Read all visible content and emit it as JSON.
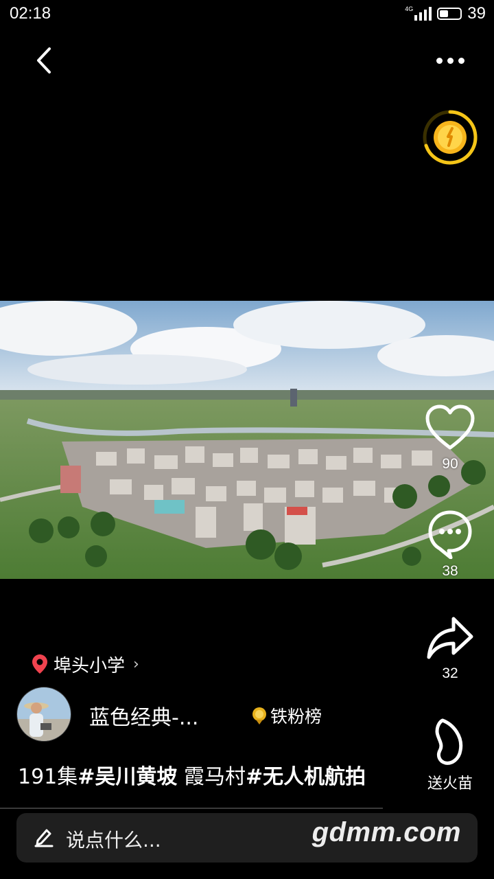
{
  "status_bar": {
    "time": "02:18",
    "network": "4G",
    "battery": "39"
  },
  "header": {
    "back_icon": "chevron-left-icon",
    "more_icon": "more-dots-icon"
  },
  "coin_widget": {
    "icon": "gold-coin-icon",
    "ring_color": "#f5c518"
  },
  "actions": {
    "like_count": "90",
    "comment_count": "38",
    "share_count": "32",
    "gift_label": "送火苗"
  },
  "location": {
    "label": "埠头小学",
    "icon": "location-pin-icon",
    "pin_color": "#f0434f"
  },
  "author": {
    "name": "蓝色经典-...",
    "badge_label": "铁粉榜",
    "badge_color": "#e8b21c"
  },
  "caption": {
    "part1": "191集",
    "part2": "#吴川黄坡",
    "part3": " 霞马村",
    "part4": "#无人机航拍"
  },
  "comment_bar": {
    "placeholder": "说点什么...",
    "watermark": "gdmm.com"
  }
}
